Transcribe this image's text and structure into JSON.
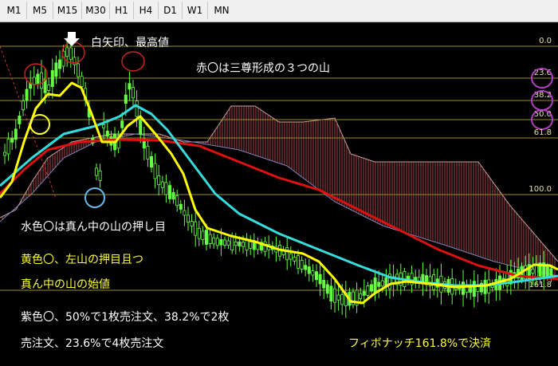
{
  "toolbar": {
    "timeframes": [
      "M1",
      "M5",
      "M15",
      "M30",
      "H1",
      "H4",
      "D1",
      "W1",
      "MN"
    ]
  },
  "chart_data": {
    "type": "candlestick",
    "fibonacci_levels": [
      {
        "label": "0.0",
        "circled": false
      },
      {
        "label": "23.6",
        "circled": true
      },
      {
        "label": "38.2",
        "circled": true
      },
      {
        "label": "50.0",
        "circled": true
      },
      {
        "label": "61.8",
        "circled": false
      },
      {
        "label": "100.0",
        "circled": false
      },
      {
        "label": "161.8",
        "circled": false
      }
    ],
    "series_colors": {
      "fast_ma": "#ffff00",
      "mid_ma": "#33dddd",
      "slow_ma": "#dd1111",
      "candles": "#66ff44",
      "cloud": "#c05050",
      "fib_lines": "#a08a2a"
    },
    "annotations": {
      "arrow_note": "白矢印、最高値",
      "red_note": "赤〇は三尊形成の３つの山",
      "cyan_note": "水色〇は真ん中の山の押し目",
      "yellow_note_1": "黄色〇、左山の押目且つ",
      "yellow_note_2": "真ん中の山の始値",
      "purple_note_1": "紫色〇、50%で1枚売注文、38.2%で2枚",
      "purple_note_2": "売注文、23.6%で4枚売注文",
      "exit_note": "フィボナッチ161.8%で決済"
    },
    "annotation_colors": {
      "arrow_note": "#ffffff",
      "red_note": "#ffffff",
      "cyan_note": "#ffffff",
      "yellow_note_1": "#ffff33",
      "yellow_note_2": "#ffff33",
      "purple_note_1": "#ffffff",
      "purple_note_2": "#ffffff",
      "exit_note": "#ffff33"
    }
  }
}
